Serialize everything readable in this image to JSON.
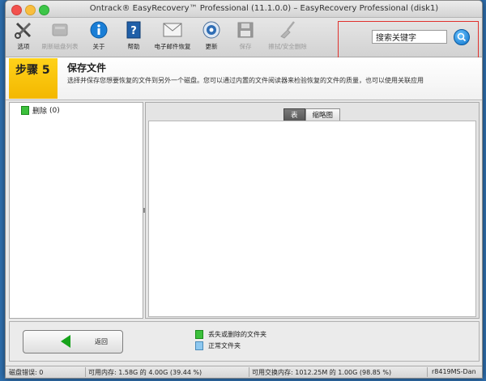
{
  "window": {
    "title": "Ontrack® EasyRecovery™ Professional (11.1.0.0) – EasyRecovery Professional (disk1)"
  },
  "toolbar": {
    "items": [
      {
        "label": "选项",
        "icon": "tools-icon",
        "enabled": true
      },
      {
        "label": "刷新磁盘列表",
        "icon": "disk-refresh-icon",
        "enabled": false
      },
      {
        "label": "关于",
        "icon": "info-icon",
        "enabled": true
      },
      {
        "label": "帮助",
        "icon": "help-book-icon",
        "enabled": true
      },
      {
        "label": "电子邮件恢复",
        "icon": "envelope-icon",
        "enabled": true
      },
      {
        "label": "更新",
        "icon": "update-icon",
        "enabled": true
      },
      {
        "label": "保存",
        "icon": "floppy-icon",
        "enabled": false
      },
      {
        "label": "擦拭/安全删除",
        "icon": "broom-icon",
        "enabled": false
      }
    ]
  },
  "search": {
    "value": "搜索关键字",
    "placeholder": "搜索关键字"
  },
  "step": {
    "label": "步骤 5",
    "title": "保存文件",
    "description": "选择并保存您想要恢复的文件到另外一个磁盘。您可以通过内置的文件阅读器来检验恢复的文件的质量，也可以使用关联应用"
  },
  "tree": {
    "items": [
      {
        "label": "删除",
        "count": "(0)"
      }
    ]
  },
  "view_tabs": {
    "tabs": [
      "表",
      "缩略图"
    ],
    "active": "表"
  },
  "bottom": {
    "back_label": "返回",
    "legend": [
      {
        "label": "丢失或删除的文件夹",
        "color": "#3cc03c"
      },
      {
        "label": "正常文件夹",
        "color": "#8ec8f0"
      }
    ]
  },
  "status": {
    "disk_errors": "磁盘错误: 0",
    "memory": "可用内存: 1.58G 的 4.00G (39.44 %)",
    "swap": "可用交换内存: 1012.25M 的 1.00G (98.85 %)",
    "build": "r8419MS-Dan"
  }
}
